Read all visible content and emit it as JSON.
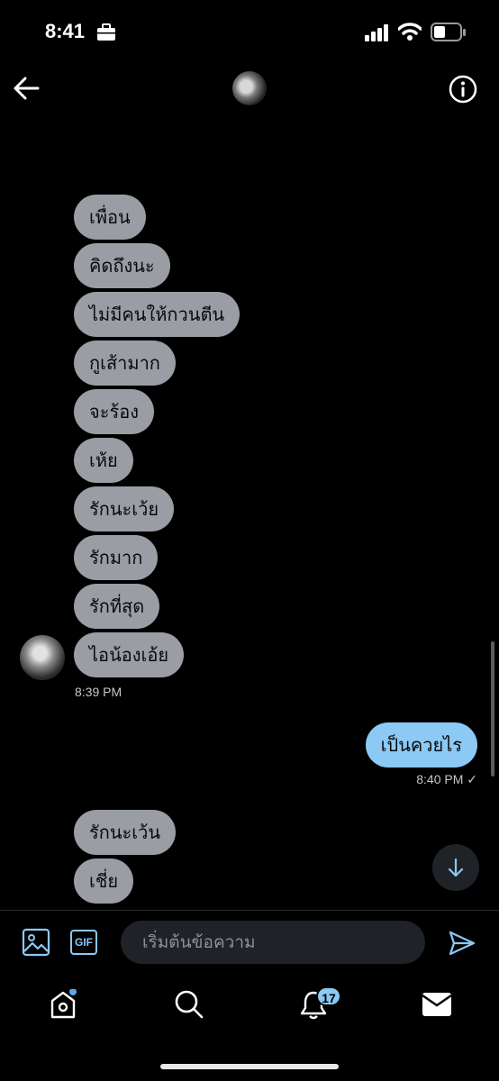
{
  "status_bar": {
    "time": "8:41"
  },
  "conversation": {
    "incoming_group_1": [
      "เพื่อน",
      "คิดถึงนะ",
      "ไม่มีคนให้กวนตีน",
      "กูเส้ามาก",
      "จะร้อง",
      "เห้ย",
      "รักนะเว้ย",
      "รักมาก",
      "รักที่สุด",
      "ไอน้องเอ้ย"
    ],
    "incoming_time": "8:39 PM",
    "outgoing": {
      "text": "เป็นควยไร",
      "time": "8:40 PM ✓"
    },
    "incoming_group_2": [
      "รักนะเว้น",
      "เชี่ย"
    ]
  },
  "composer": {
    "placeholder": "เริ่มต้นข้อความ",
    "gif_label": "GIF"
  },
  "bottom_nav": {
    "notifications_badge": "17"
  },
  "colors": {
    "accent": "#8cc9f5",
    "incoming_bubble": "#9a9da4",
    "background": "#000000"
  },
  "icons": [
    "briefcase-icon",
    "signal-icon",
    "wifi-icon",
    "battery-icon",
    "back-arrow-icon",
    "info-icon",
    "image-icon",
    "gif-icon",
    "send-icon",
    "home-icon",
    "search-icon",
    "bell-icon",
    "mail-icon",
    "arrow-down-icon"
  ]
}
